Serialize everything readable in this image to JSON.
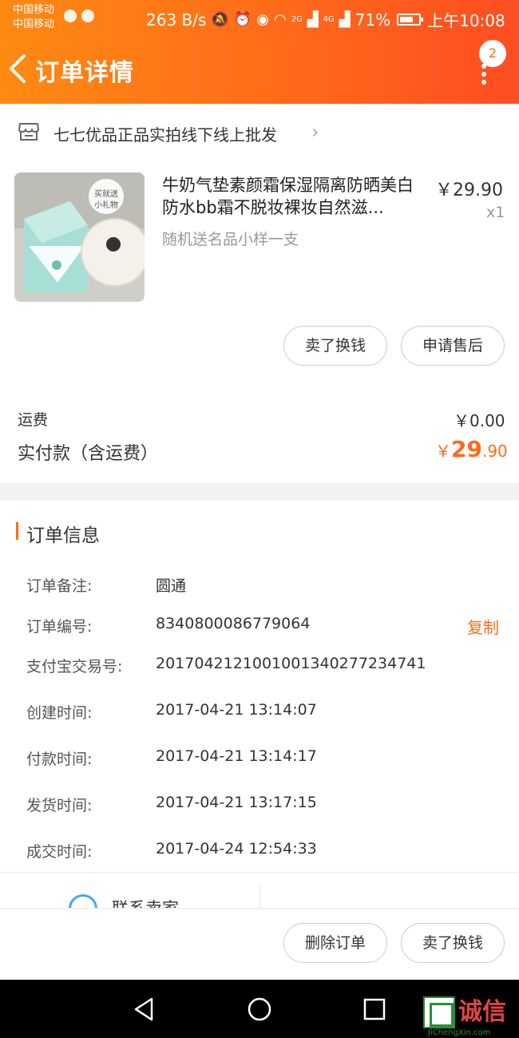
{
  "status_bar": {
    "carrier_1": "中国移动",
    "carrier_2": "中国移动",
    "speed": "263 B/s",
    "network_2g": "2G",
    "network_4g": "4G",
    "battery": "71%",
    "time": "上午10:08"
  },
  "header": {
    "title": "订单详情",
    "badge_count": "2"
  },
  "shop": {
    "name": "七七优品正品实拍线下线上批发"
  },
  "product": {
    "title": "牛奶气垫素颜霜保湿隔离防晒美白防水bb霜不脱妆裸妆自然滋...",
    "subtitle": "随机送名品小样一支",
    "price": "￥29.90",
    "quantity": "x1",
    "image_caption": "买就送小礼物",
    "image_alt": "cushion-product-photo"
  },
  "item_actions": {
    "sell_label": "卖了换钱",
    "after_sale_label": "申请售后"
  },
  "totals": {
    "shipping_label": "运费",
    "shipping_value": "￥0.00",
    "paid_label": "实付款（含运费）",
    "paid_currency": "￥",
    "paid_int": "29",
    "paid_dec": ".90"
  },
  "order_info": {
    "section_title": "订单信息",
    "rows": [
      {
        "label": "订单备注:",
        "value": "圆通"
      },
      {
        "label": "订单编号:",
        "value": "8340800086779064"
      },
      {
        "label": "支付宝交易号:",
        "value": "2017042121001001340277234741"
      },
      {
        "label": "创建时间:",
        "value": "2017-04-21 13:14:07"
      },
      {
        "label": "付款时间:",
        "value": "2017-04-21 13:14:17"
      },
      {
        "label": "发货时间:",
        "value": "2017-04-21 13:17:15"
      },
      {
        "label": "成交时间:",
        "value": "2017-04-24 12:54:33"
      }
    ],
    "copy_label": "复制",
    "contact_label": "联系卖家"
  },
  "bottom_actions": {
    "delete_label": "删除订单",
    "sell_label": "卖了换钱"
  },
  "watermark": {
    "text": "诚信",
    "url": "JiChengXin.com"
  },
  "colors": {
    "accent": "#ff6a1a",
    "header_start": "#ff8a12",
    "header_end": "#ff4d22"
  }
}
